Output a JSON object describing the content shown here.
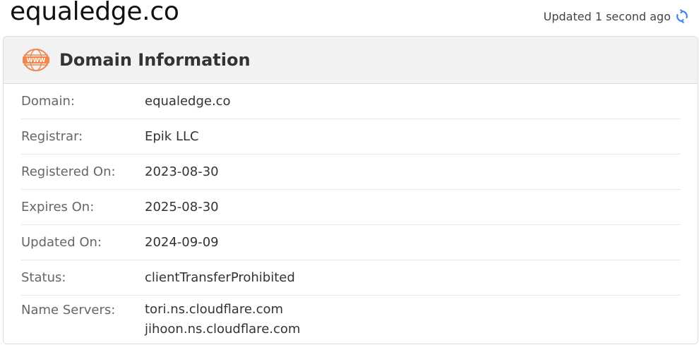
{
  "header": {
    "domain_title": "equaledge.co",
    "updated_text": "Updated 1 second ago",
    "refresh_icon": "refresh-icon",
    "accent_color": "#3b82f6"
  },
  "card": {
    "icon": "www-icon",
    "icon_color": "#f0874f",
    "title": "Domain Information",
    "rows": [
      {
        "label": "Domain:",
        "value": "equaledge.co"
      },
      {
        "label": "Registrar:",
        "value": "Epik LLC"
      },
      {
        "label": "Registered On:",
        "value": "2023-08-30"
      },
      {
        "label": "Expires On:",
        "value": "2025-08-30"
      },
      {
        "label": "Updated On:",
        "value": "2024-09-09"
      },
      {
        "label": "Status:",
        "value": "clientTransferProhibited"
      }
    ],
    "name_servers": {
      "label": "Name Servers:",
      "values": [
        "tori.ns.cloudflare.com",
        "jihoon.ns.cloudflare.com"
      ]
    }
  }
}
